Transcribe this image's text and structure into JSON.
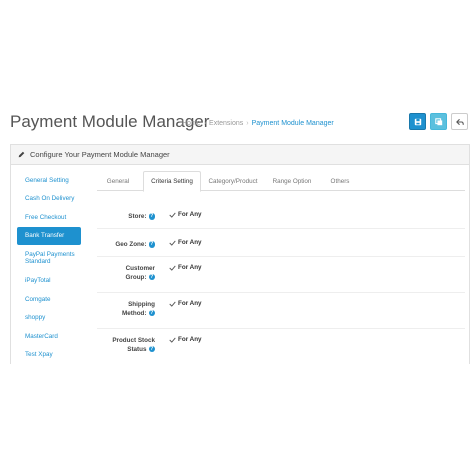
{
  "header": {
    "title": "Payment Module Manager",
    "breadcrumb": [
      "Home",
      "Extensions",
      "Payment Module Manager"
    ],
    "breadcrumb_sep": "›"
  },
  "actions": [
    {
      "icon": "save-icon",
      "color": "#1e91cf"
    },
    {
      "icon": "copy-icon",
      "color": "#5bc0de"
    },
    {
      "icon": "reply-icon",
      "color": "#ffffff"
    }
  ],
  "panel": {
    "heading": "Configure Your Payment Module Manager",
    "heading_icon": "pencil-icon"
  },
  "sidebar": {
    "items": [
      {
        "label": "General Setting",
        "active": false
      },
      {
        "label": "Cash On Delivery",
        "active": false
      },
      {
        "label": "Free Checkout",
        "active": false
      },
      {
        "label": "Bank Transfer",
        "active": true
      },
      {
        "label": "PayPal Payments Standard",
        "active": false
      },
      {
        "label": "iPayTotal",
        "active": false
      },
      {
        "label": "Comgate",
        "active": false
      },
      {
        "label": "shoppy",
        "active": false
      },
      {
        "label": "MasterCard",
        "active": false
      },
      {
        "label": "Test Xpay",
        "active": false
      }
    ]
  },
  "tabs": [
    {
      "label": "General",
      "active": false
    },
    {
      "label": "Criteria Setting",
      "active": true
    },
    {
      "label": "Category/Product",
      "active": false
    },
    {
      "label": "Range Option",
      "active": false
    },
    {
      "label": "Others",
      "active": false
    }
  ],
  "criteria": [
    {
      "label_lines": [
        "Store:"
      ],
      "value": "For Any"
    },
    {
      "label_lines": [
        "Geo Zone:"
      ],
      "value": "For Any"
    },
    {
      "label_lines": [
        "Customer",
        "Group:"
      ],
      "value": "For Any"
    },
    {
      "label_lines": [
        "Shipping",
        "Method:"
      ],
      "value": "For Any"
    },
    {
      "label_lines": [
        "Product Stock",
        "Status"
      ],
      "value": "For Any"
    }
  ],
  "help_glyph": "?",
  "colors": {
    "accent": "#1e91cf",
    "info": "#5bc0de",
    "text": "#333333",
    "muted": "#999999"
  }
}
